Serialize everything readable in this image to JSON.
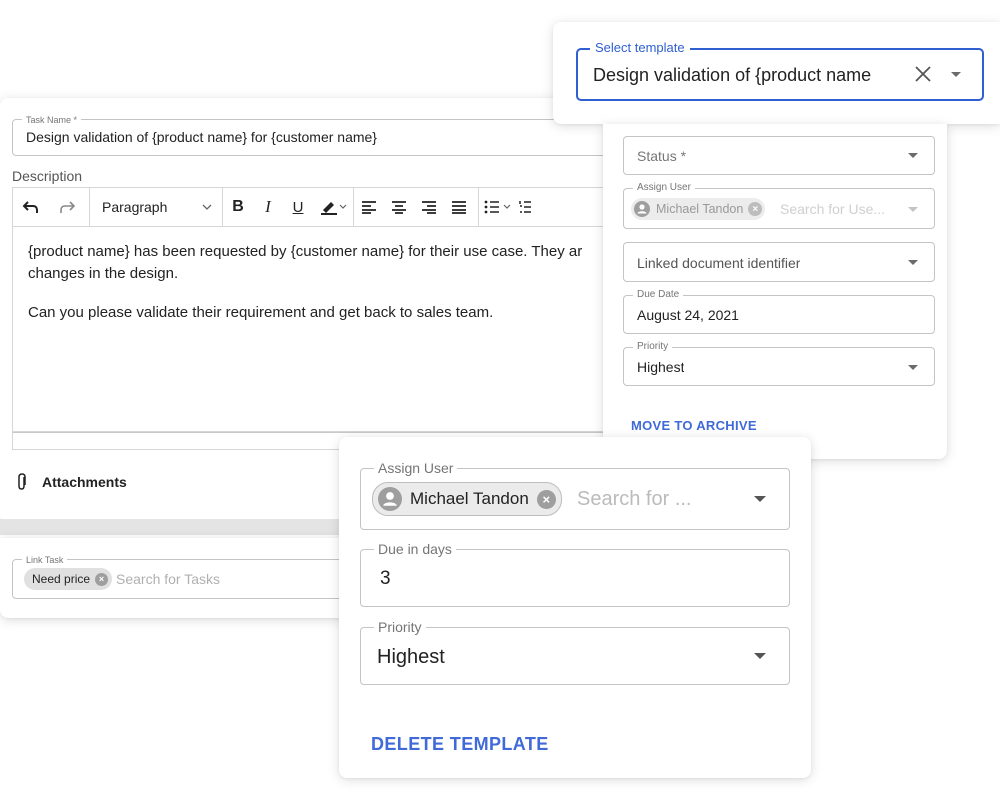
{
  "task_editor": {
    "task_name_label": "Task Name *",
    "task_name_value": "Design validation of {product name} for {customer name}",
    "description_label": "Description",
    "toolbar": {
      "undo_icon": "undo-icon",
      "redo_icon": "redo-icon",
      "paragraph_label": "Paragraph",
      "bold_label": "B",
      "italic_label": "I",
      "underline_label": "U"
    },
    "editor_paragraphs": [
      "{product name} has been requested by {customer name} for their use case. They ar",
      "changes in the design.",
      "Can you please validate their requirement and get back to sales team."
    ],
    "attachments_label": "Attachments",
    "link_task": {
      "label": "Link Task",
      "chip": "Need price",
      "placeholder": "Search for Tasks"
    }
  },
  "template_select": {
    "label": "Select template",
    "value": "Design validation of {product name",
    "clear_icon": "close-icon"
  },
  "task_meta_panel": {
    "status_placeholder": "Status *",
    "assign_user_label": "Assign User",
    "assign_user_chip": "Michael Tandon",
    "assign_user_placeholder": "Search for Use...",
    "linked_doc_placeholder": "Linked document identifier",
    "due_date_label": "Due Date",
    "due_date_value": "August 24, 2021",
    "priority_label": "Priority",
    "priority_value": "Highest",
    "archive_label": "MOVE TO ARCHIVE"
  },
  "template_panel": {
    "assign_user_label": "Assign User",
    "assign_user_chip": "Michael Tandon",
    "assign_user_placeholder": "Search for ...",
    "due_days_label": "Due in days",
    "due_days_value": "3",
    "priority_label": "Priority",
    "priority_value": "Highest",
    "delete_label": "DELETE TEMPLATE"
  },
  "colors": {
    "accent": "#3f6ad8",
    "select_border": "#2f5fd0"
  }
}
